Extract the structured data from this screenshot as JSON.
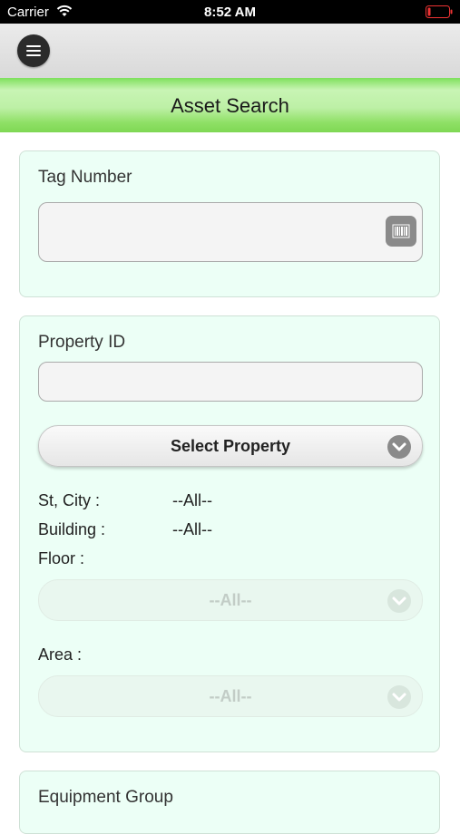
{
  "status_bar": {
    "carrier": "Carrier",
    "time": "8:52 AM"
  },
  "header": {
    "title": "Asset Search"
  },
  "tag_section": {
    "label": "Tag Number",
    "value": ""
  },
  "property_section": {
    "label": "Property ID",
    "value": "",
    "select_label": "Select Property",
    "st_city_label": "St, City :",
    "st_city_value": "--All--",
    "building_label": "Building :",
    "building_value": "--All--",
    "floor_label": "Floor :",
    "floor_value": "--All--",
    "area_label": "Area :",
    "area_value": "--All--"
  },
  "equipment_section": {
    "label": "Equipment Group"
  }
}
